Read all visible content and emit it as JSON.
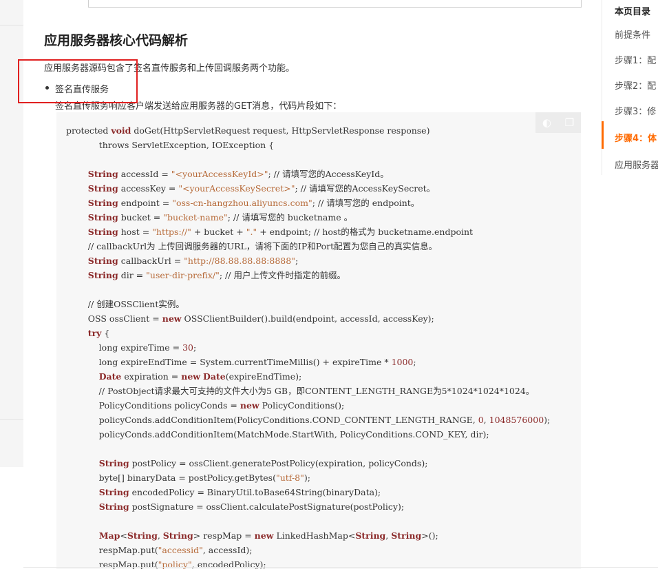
{
  "page": {
    "section_title": "应用服务器核心代码解析",
    "intro": "应用服务器源码包含了签名直传服务和上传回调服务两个功能。",
    "bullet": "签名直传服务",
    "bullet_desc": "签名直传服务响应客户端发送给应用服务器的GET消息，代码片段如下："
  },
  "code_tools": {
    "icons": [
      "theme-toggle-icon",
      "copy-icon"
    ]
  },
  "code_lines": [
    "protected void doGet(HttpServletRequest request, HttpServletResponse response)",
    "            throws ServletException, IOException {",
    "",
    "        String accessId = \"<yourAccessKeyId>\"; // 请填写您的AccessKeyId。",
    "        String accessKey = \"<yourAccessKeySecret>\"; // 请填写您的AccessKeySecret。",
    "        String endpoint = \"oss-cn-hangzhou.aliyuncs.com\"; // 请填写您的 endpoint。",
    "        String bucket = \"bucket-name\"; // 请填写您的 bucketname 。",
    "        String host = \"https://\" + bucket + \".\" + endpoint; // host的格式为 bucketname.endpoint",
    "        // callbackUrl为 上传回调服务器的URL，请将下面的IP和Port配置为您自己的真实信息。",
    "        String callbackUrl = \"http://88.88.88.88:8888\";",
    "        String dir = \"user-dir-prefix/\"; // 用户上传文件时指定的前缀。",
    "",
    "        // 创建OSSClient实例。",
    "        OSS ossClient = new OSSClientBuilder().build(endpoint, accessId, accessKey);",
    "        try {",
    "            long expireTime = 30;",
    "            long expireEndTime = System.currentTimeMillis() + expireTime * 1000;",
    "            Date expiration = new Date(expireEndTime);",
    "            // PostObject请求最大可支持的文件大小为5 GB，即CONTENT_LENGTH_RANGE为5*1024*1024*1024。",
    "            PolicyConditions policyConds = new PolicyConditions();",
    "            policyConds.addConditionItem(PolicyConditions.COND_CONTENT_LENGTH_RANGE, 0, 1048576000);",
    "            policyConds.addConditionItem(MatchMode.StartWith, PolicyConditions.COND_KEY, dir);",
    "",
    "            String postPolicy = ossClient.generatePostPolicy(expiration, policyConds);",
    "            byte[] binaryData = postPolicy.getBytes(\"utf-8\");",
    "            String encodedPolicy = BinaryUtil.toBase64String(binaryData);",
    "            String postSignature = ossClient.calculatePostSignature(postPolicy);",
    "",
    "            Map<String, String> respMap = new LinkedHashMap<String, String>();",
    "            respMap.put(\"accessid\", accessId);",
    "            respMap.put(\"policy\", encodedPolicy);"
  ],
  "toc": {
    "title": "本页目录",
    "items": [
      "前提条件",
      "步骤1：配",
      "步骤2：配",
      "步骤3：修",
      "步骤4：体",
      "应用服务器"
    ],
    "active_index": 4
  },
  "colors": {
    "accent": "#ff6a00",
    "highlight_box": "#e02020",
    "code_bg": "#f7f7f7"
  }
}
